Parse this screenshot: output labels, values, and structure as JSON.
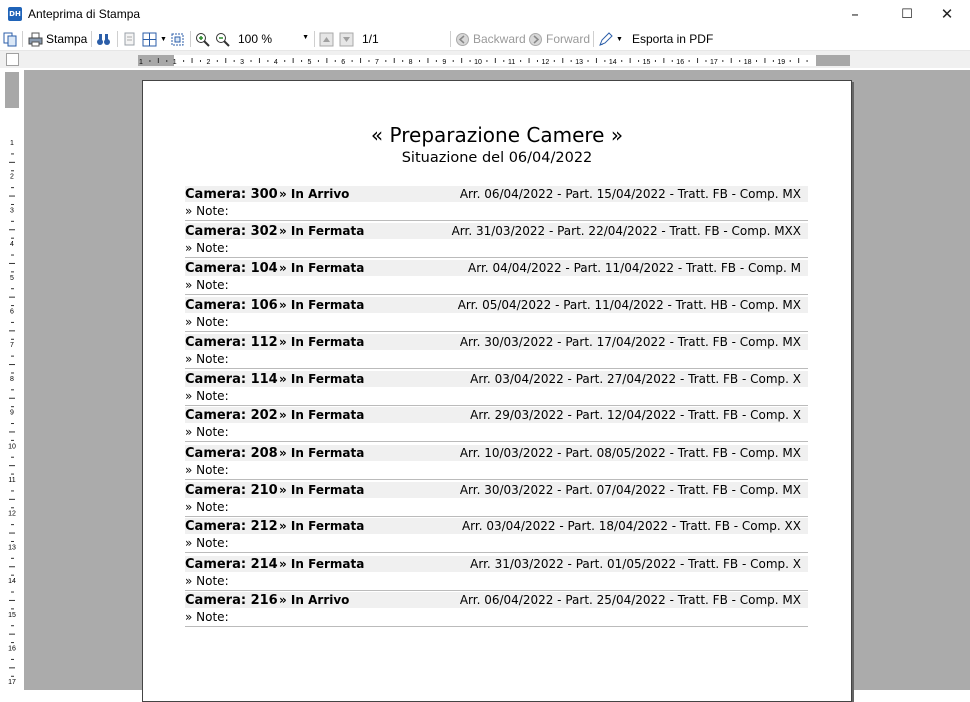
{
  "window": {
    "title": "Anteprima di Stampa",
    "app_icon_text": "DH",
    "controls": {
      "minimize": "–",
      "maximize": "☐",
      "close": "✕"
    }
  },
  "toolbar": {
    "print_label": "Stampa",
    "zoom_value": "100 %",
    "page_indicator": "1/1",
    "backward_label": "Backward",
    "forward_label": "Forward",
    "export_pdf_label": "Esporta in PDF"
  },
  "ruler": {
    "h_numbers": [
      "1",
      "1",
      "2",
      "3",
      "4",
      "5",
      "6",
      "7",
      "8",
      "9",
      "10",
      "11",
      "12",
      "13",
      "14",
      "15",
      "16",
      "17",
      "18",
      "19"
    ],
    "v_numbers": [
      "1",
      "2",
      "3",
      "4",
      "5",
      "6",
      "7",
      "8",
      "9",
      "10",
      "11",
      "12",
      "13",
      "14",
      "15",
      "16",
      "17"
    ]
  },
  "report": {
    "title": "« Preparazione Camere »",
    "subtitle": "Situazione del 06/04/2022",
    "rooms": [
      {
        "camera": "Camera: 300",
        "status": "» In Arrivo",
        "info": "Arr. 06/04/2022 - Part. 15/04/2022 - Tratt. FB - Comp. MX",
        "note": "» Note:"
      },
      {
        "camera": "Camera: 302",
        "status": "» In Fermata",
        "info": "Arr. 31/03/2022 - Part. 22/04/2022 - Tratt. FB - Comp. MXX",
        "note": "» Note:"
      },
      {
        "camera": "Camera: 104",
        "status": "» In Fermata",
        "info": "Arr. 04/04/2022 - Part. 11/04/2022 - Tratt. FB - Comp. M",
        "note": "» Note:"
      },
      {
        "camera": "Camera: 106",
        "status": "» In Fermata",
        "info": "Arr. 05/04/2022 - Part. 11/04/2022 - Tratt. HB - Comp. MX",
        "note": "» Note:"
      },
      {
        "camera": "Camera: 112",
        "status": "» In Fermata",
        "info": "Arr. 30/03/2022 - Part. 17/04/2022 - Tratt. FB - Comp. MX",
        "note": "» Note:"
      },
      {
        "camera": "Camera: 114",
        "status": "» In Fermata",
        "info": "Arr. 03/04/2022 - Part. 27/04/2022 - Tratt. FB - Comp. X",
        "note": "» Note:"
      },
      {
        "camera": "Camera: 202",
        "status": "» In Fermata",
        "info": "Arr. 29/03/2022 - Part. 12/04/2022 - Tratt. FB - Comp. X",
        "note": "» Note:"
      },
      {
        "camera": "Camera: 208",
        "status": "» In Fermata",
        "info": "Arr. 10/03/2022 - Part. 08/05/2022 - Tratt. FB - Comp. MX",
        "note": "» Note:"
      },
      {
        "camera": "Camera: 210",
        "status": "» In Fermata",
        "info": "Arr. 30/03/2022 - Part. 07/04/2022 - Tratt. FB - Comp. MX",
        "note": "» Note:"
      },
      {
        "camera": "Camera: 212",
        "status": "» In Fermata",
        "info": "Arr. 03/04/2022 - Part. 18/04/2022 - Tratt. FB - Comp. XX",
        "note": "» Note:"
      },
      {
        "camera": "Camera: 214",
        "status": "» In Fermata",
        "info": "Arr. 31/03/2022 - Part. 01/05/2022 - Tratt. FB - Comp. X",
        "note": "» Note:"
      },
      {
        "camera": "Camera: 216",
        "status": "» In Arrivo",
        "info": "Arr. 06/04/2022 - Part. 25/04/2022 - Tratt. FB - Comp. MX",
        "note": "» Note:"
      }
    ]
  }
}
